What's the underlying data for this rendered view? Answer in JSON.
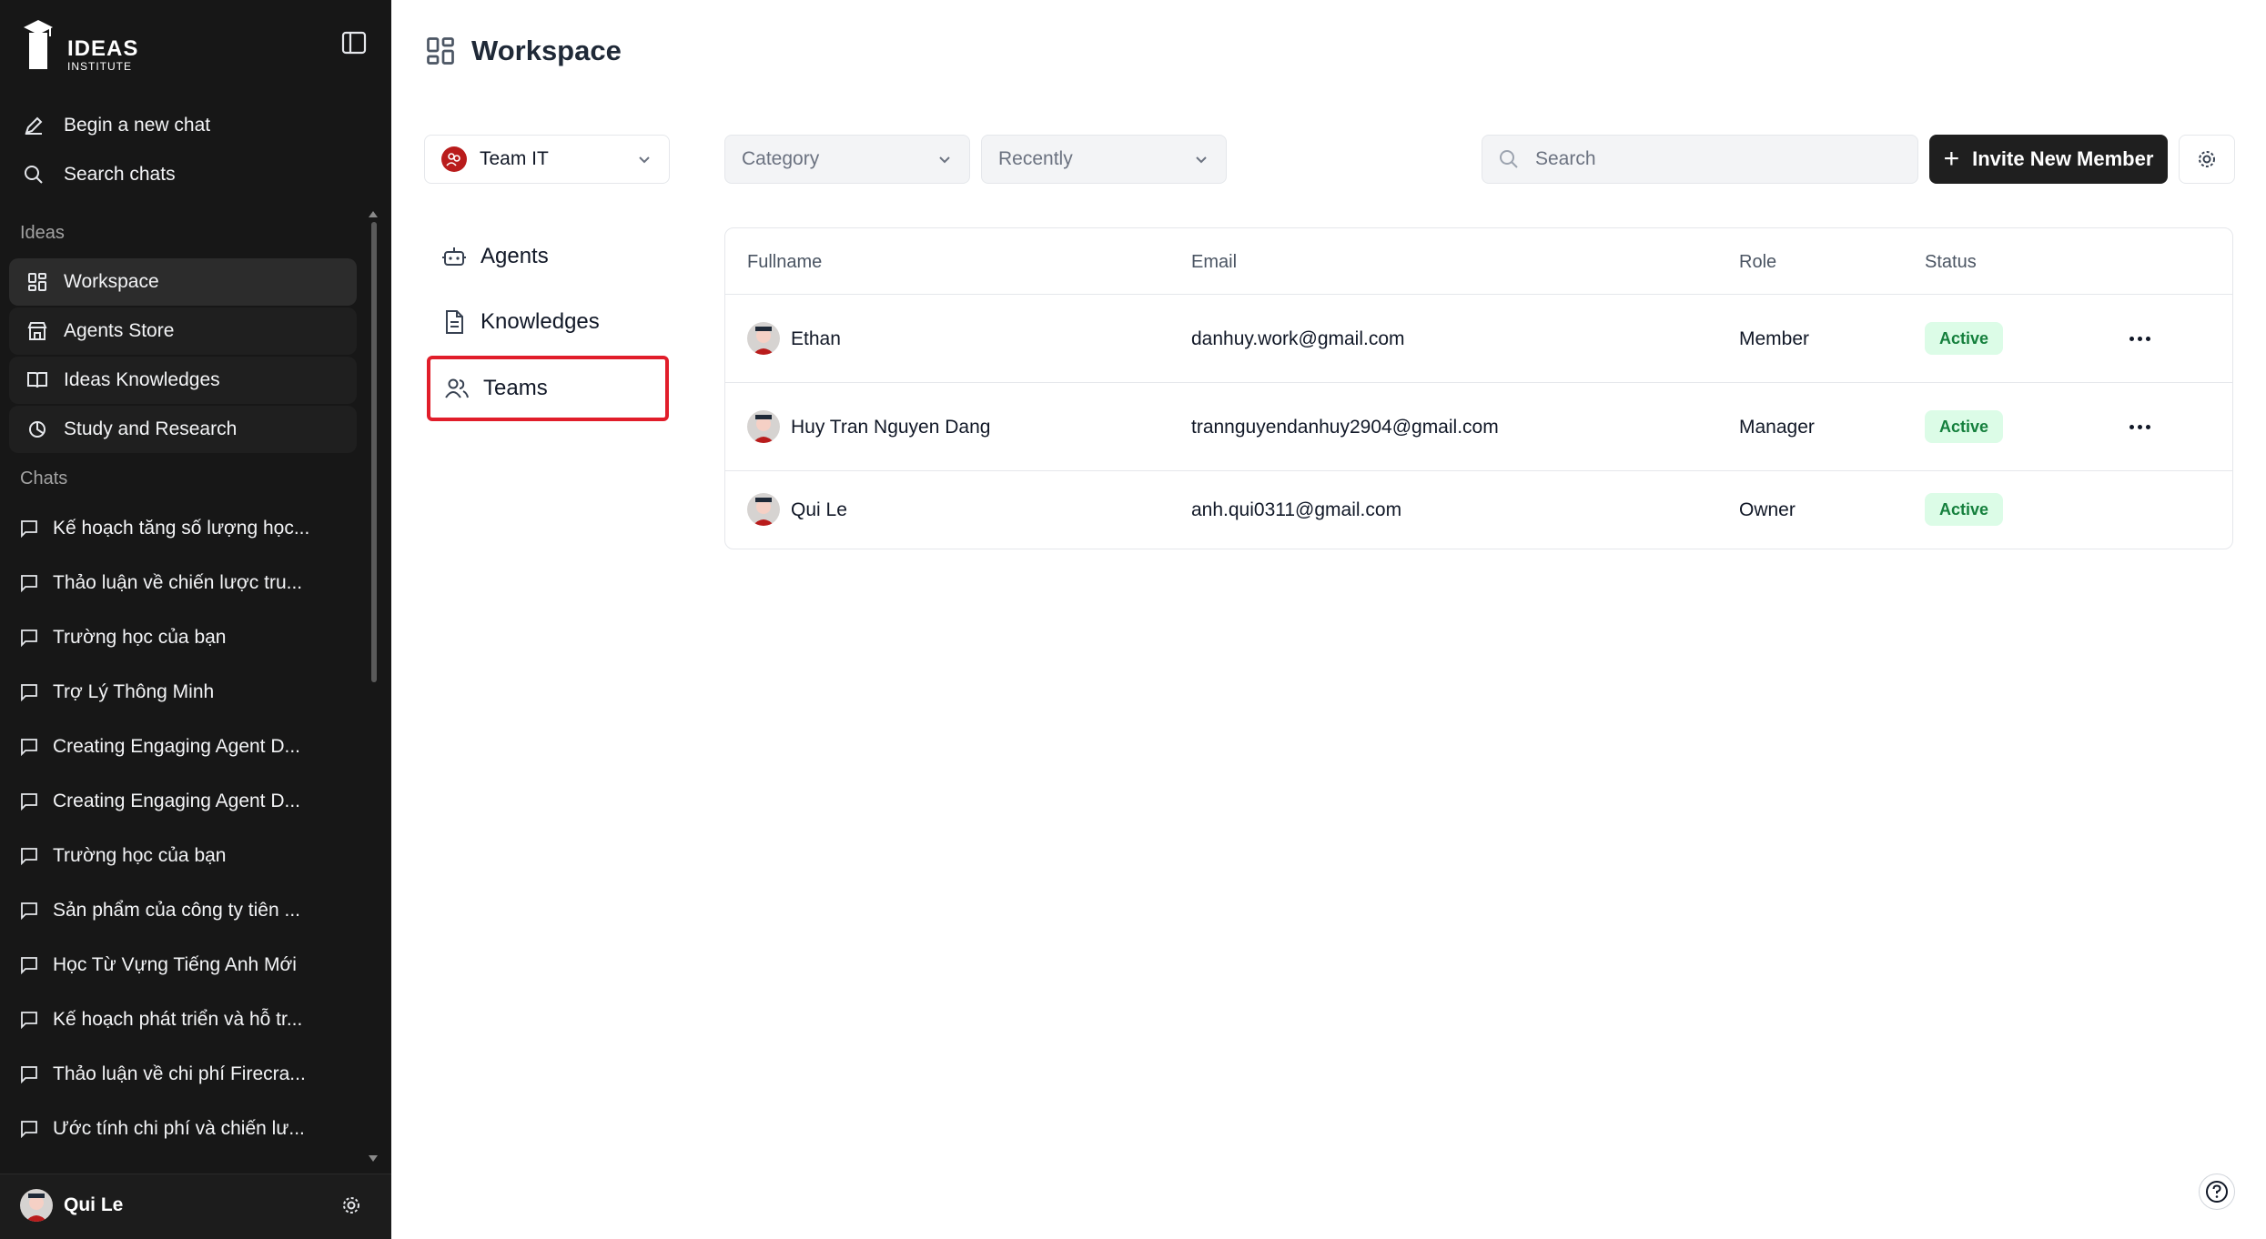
{
  "sidebar": {
    "logo_text": "IDEAS",
    "logo_sub": "INSTITUTE",
    "actions": [
      {
        "label": "Begin a new chat",
        "icon": "pencil-icon"
      },
      {
        "label": "Search chats",
        "icon": "search-icon"
      }
    ],
    "ideas_label": "Ideas",
    "nav": [
      {
        "label": "Workspace",
        "icon": "grid-icon",
        "active": true
      },
      {
        "label": "Agents Store",
        "icon": "store-icon"
      },
      {
        "label": "Ideas Knowledges",
        "icon": "book-icon"
      },
      {
        "label": "Study and Research",
        "icon": "study-icon"
      }
    ],
    "chats_label": "Chats",
    "chats": [
      "Kế hoạch tăng số lượng học...",
      "Thảo luận về chiến lược tru...",
      "Trường học của bạn",
      "Trợ Lý Thông Minh",
      "Creating Engaging Agent D...",
      "Creating Engaging Agent D...",
      "Trường học của bạn",
      "Sản phẩm của công ty tiên ...",
      "Học Từ Vựng Tiếng Anh Mới",
      "Kế hoạch phát triển và hỗ tr...",
      "Thảo luận về chi phí Firecra...",
      "Ước tính chi phí và chiến lư..."
    ],
    "user": {
      "name": "Qui Le"
    }
  },
  "main": {
    "title": "Workspace",
    "team_select": {
      "value": "Team IT"
    },
    "left_nav": [
      {
        "label": "Agents",
        "icon": "robot-icon"
      },
      {
        "label": "Knowledges",
        "icon": "document-icon"
      },
      {
        "label": "Teams",
        "icon": "users-icon",
        "selected": true
      }
    ],
    "filters": {
      "category": "Category",
      "sort": "Recently"
    },
    "search": {
      "placeholder": "Search"
    },
    "invite_label": "Invite New Member",
    "table": {
      "columns": [
        "Fullname",
        "Email",
        "Role",
        "Status"
      ],
      "rows": [
        {
          "name": "Ethan",
          "email": "danhuy.work@gmail.com",
          "role": "Member",
          "status": "Active",
          "has_menu": true
        },
        {
          "name": "Huy Tran Nguyen Dang",
          "email": "trannguyendanhuy2904@gmail.com",
          "role": "Manager",
          "status": "Active",
          "has_menu": true
        },
        {
          "name": "Qui Le",
          "email": "anh.qui0311@gmail.com",
          "role": "Owner",
          "status": "Active",
          "has_menu": false
        }
      ]
    }
  },
  "colors": {
    "sidebar_bg": "#171717",
    "highlight_border": "#e11d2a",
    "status_bg": "#dcfce7",
    "status_text": "#15803d",
    "invite_bg": "#1f1f1f"
  }
}
